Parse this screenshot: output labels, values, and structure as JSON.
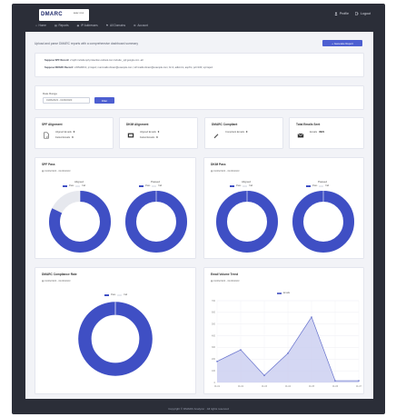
{
  "app": {
    "logo_text": "DMARC",
    "logo_sub": "ANALYZER",
    "topright": [
      {
        "icon": "user-icon",
        "label": "Profile"
      },
      {
        "icon": "logout-icon",
        "label": "Logout"
      }
    ],
    "menu": [
      {
        "icon": "home-icon",
        "label": "Home"
      },
      {
        "icon": "report-icon",
        "label": "Reports"
      },
      {
        "icon": "ip-icon",
        "label": "IP Addresses"
      },
      {
        "icon": "domain-icon",
        "label": "All Domains"
      },
      {
        "icon": "gear-icon",
        "label": "Account"
      }
    ],
    "footer": "Copyright © DMARC Analyzer · All rights reserved"
  },
  "intro": {
    "description": "Upload and parse DMARC reports with a comprehensive dashboard summary",
    "generate_button": "Generate Report",
    "info_lines": [
      {
        "label": "Suppose SPF Record:",
        "text": "v=spf1 include:spf.protection.outlook.com include:_spf.google.com -all"
      },
      {
        "label": "Suppose DMARC Record:",
        "text": "v=DMARC1; p=reject; rua=mailto:dmarc@example.com; ruf=mailto:dmarc@example.com; fo=1; adkim=s; aspf=s; pct=100; sp=reject"
      }
    ]
  },
  "filter": {
    "label": "Date Range",
    "date_value": "01/06/2023 - 01/06/2023",
    "button": "Filter"
  },
  "stats": [
    {
      "title": "SPF Alignment",
      "icon": "document-icon",
      "rows": [
        {
          "label": "Aligned Emails",
          "value": "0"
        },
        {
          "label": "Failed Emails",
          "value": "0"
        }
      ]
    },
    {
      "title": "DKIM Alignment",
      "icon": "key-icon",
      "rows": [
        {
          "label": "Aligned Emails",
          "value": "0"
        },
        {
          "label": "Failed Emails",
          "value": "0"
        }
      ]
    },
    {
      "title": "DMARC Compliant",
      "icon": "pencil-icon",
      "rows": [
        {
          "label": "Compliant Emails",
          "value": "0"
        }
      ]
    },
    {
      "title": "Total Emails Sent",
      "icon": "mail-icon",
      "rows": [
        {
          "label": "Emails",
          "value": "3021"
        }
      ]
    }
  ],
  "spf_panel": {
    "title": "SPF Pass",
    "date": "01/06/2023 - 01/06/2023",
    "charts": [
      {
        "title": "Aligned",
        "legend": [
          "Pass",
          "Fail"
        ],
        "pass": 0.82,
        "fail": 0.18
      },
      {
        "title": "Passed",
        "legend": [
          "Pass",
          "Fail"
        ],
        "pass": 1.0,
        "fail": 0.0
      }
    ]
  },
  "dkim_panel": {
    "title": "DKIM Pass",
    "date": "01/06/2023 - 01/06/2023",
    "charts": [
      {
        "title": "Aligned",
        "legend": [
          "Pass",
          "Fail"
        ],
        "pass": 1.0,
        "fail": 0.0
      },
      {
        "title": "Passed",
        "legend": [
          "Pass",
          "Fail"
        ],
        "pass": 1.0,
        "fail": 0.0
      }
    ]
  },
  "compliance_panel": {
    "title": "DMARC Compliance Rate",
    "date": "01/06/2023 - 01/06/2023",
    "legend": [
      "Pass",
      "Fail"
    ],
    "pass": 1.0
  },
  "volume_panel": {
    "title": "Email Volume Trend",
    "date": "01/06/2023 - 01/06/2023",
    "legend": "Emails"
  },
  "colors": {
    "primary": "#4d5fd1",
    "donut_pass": "#3f4fc4",
    "donut_fail": "#e6e8ee",
    "area_fill": "#c9cdf0",
    "area_stroke": "#6470cc",
    "dark_frame": "#2b2e38"
  },
  "chart_data": {
    "type": "area",
    "x": [
      "01-01",
      "01-02",
      "01-03",
      "01-04",
      "01-05",
      "01-06",
      "01-07"
    ],
    "series": [
      {
        "name": "Emails",
        "values": [
          180,
          280,
          60,
          250,
          560,
          15,
          15
        ]
      }
    ],
    "ylim": [
      0,
      700
    ],
    "yticks": [
      0,
      100,
      200,
      300,
      400,
      500,
      600,
      700
    ],
    "grid": true,
    "legend": "top"
  }
}
